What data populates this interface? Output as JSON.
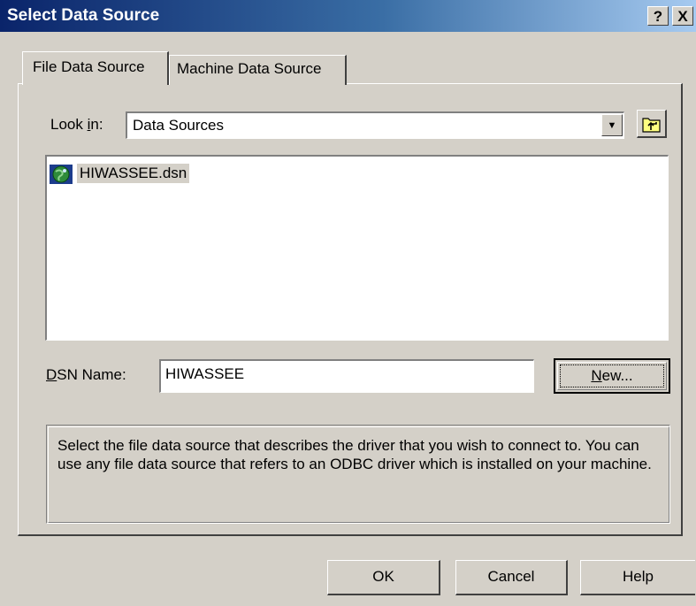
{
  "window": {
    "title": "Select Data Source",
    "help_glyph": "?",
    "close_glyph": "X"
  },
  "tabs": [
    {
      "label": "File Data Source",
      "active": true
    },
    {
      "label": "Machine Data Source",
      "active": false
    }
  ],
  "look_in": {
    "label_prefix": "Look ",
    "label_mnemonic": "i",
    "label_suffix": "n:",
    "value": "Data Sources",
    "up_folder_icon": "up-folder-icon"
  },
  "file_list": {
    "items": [
      {
        "name": "HIWASSEE.dsn",
        "icon": "dsn-globe-icon",
        "selected": true
      }
    ]
  },
  "dsn_name": {
    "label_mnemonic": "D",
    "label_rest": "SN Name:",
    "value": "HIWASSEE"
  },
  "buttons": {
    "new_mnemonic": "N",
    "new_rest": "ew...",
    "ok": "OK",
    "cancel": "Cancel",
    "help": "Help"
  },
  "description": "Select the file data source that describes the driver that you wish to connect to. You can use any file data source that refers to an ODBC driver which is installed on your machine.",
  "colors": {
    "face": "#d4d0c8",
    "title_start": "#0a246a",
    "title_end": "#a6caf0"
  }
}
